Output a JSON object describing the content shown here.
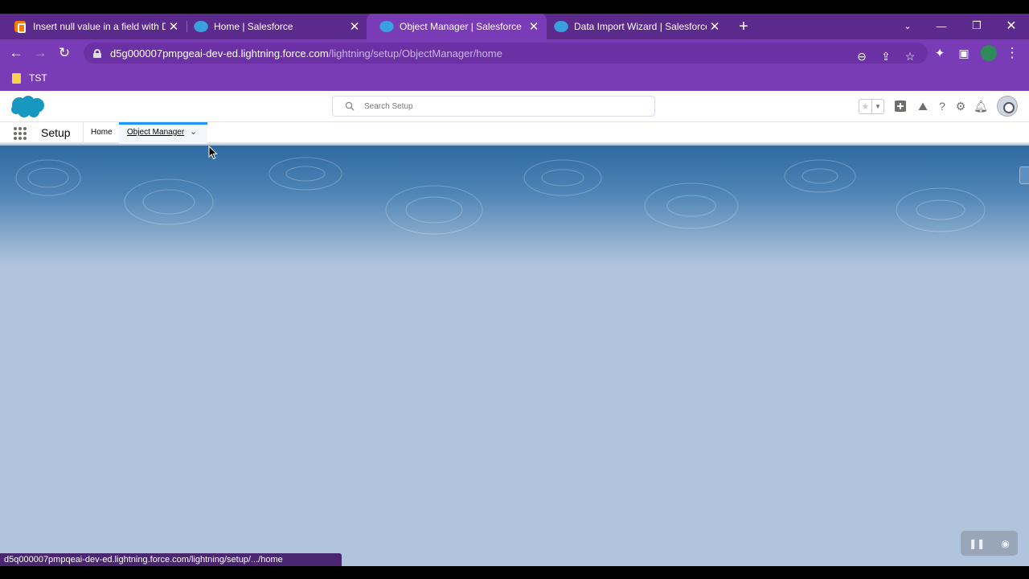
{
  "browser": {
    "tabs": [
      {
        "title": "Insert null value in a field with Da",
        "favicon": "blogger-icon",
        "active": false
      },
      {
        "title": "Home | Salesforce",
        "favicon": "salesforce-cloud-icon",
        "active": false
      },
      {
        "title": "Object Manager | Salesforce",
        "favicon": "salesforce-cloud-icon",
        "active": true
      },
      {
        "title": "Data Import Wizard | Salesforce",
        "favicon": "salesforce-cloud-icon",
        "active": false
      }
    ],
    "url_host": "d5g000007pmpgeai-dev-ed.lightning.force.com",
    "url_path": "/lightning/setup/ObjectManager/home",
    "bookmark_label": "TST",
    "status_url": "d5q000007pmpqeai-dev-ed.lightning.force.com/lightning/setup/.../home",
    "colors": {
      "frame": "#7a3cb6",
      "tabstrip": "#5b2a8c"
    }
  },
  "salesforce": {
    "search_placeholder": "Search Setup",
    "app_name": "Setup",
    "nav": {
      "home": "Home",
      "object_manager": "Object Manager"
    },
    "colors": {
      "brand_blue": "#1b96ff",
      "banner": "#2e6aa0",
      "page_bg": "#b0c4de"
    }
  }
}
